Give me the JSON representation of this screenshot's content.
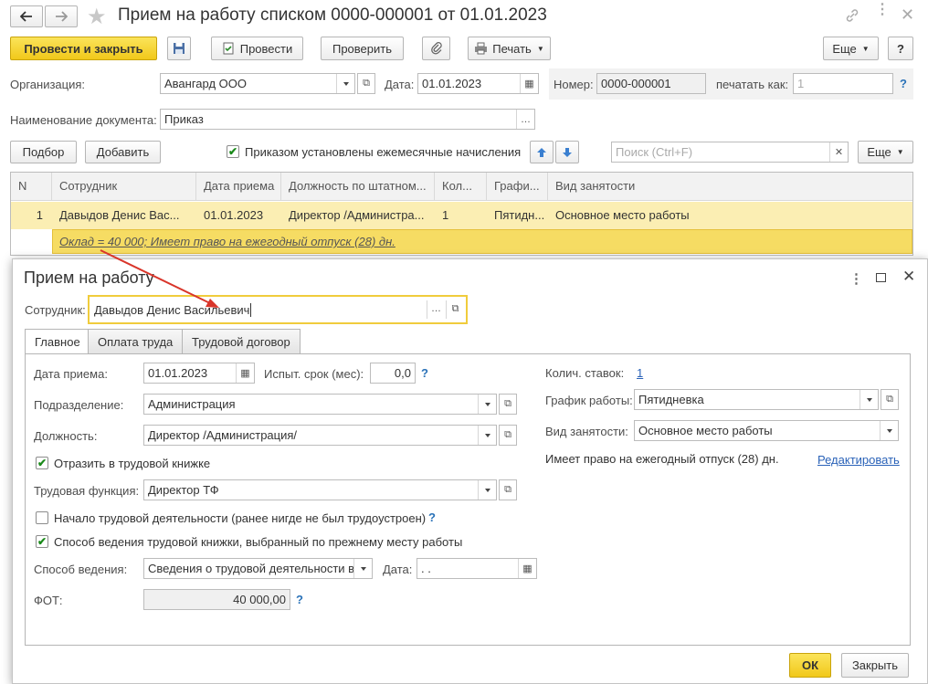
{
  "window": {
    "title": "Прием на работу списком 0000-000001 от 01.01.2023",
    "post_close": "Провести и закрыть",
    "post": "Провести",
    "check": "Проверить",
    "print": "Печать",
    "more": "Еще",
    "help": "?"
  },
  "header": {
    "org_label": "Организация:",
    "org_value": "Авангард ООО",
    "date_label": "Дата:",
    "date_value": "01.01.2023",
    "number_label": "Номер:",
    "number_value": "0000-000001",
    "print_as_label": "печатать как:",
    "print_as_value": "1",
    "help": "?",
    "docname_label": "Наименование документа:",
    "docname_value": "Приказ"
  },
  "toolbar2": {
    "select": "Подбор",
    "add": "Добавить",
    "monthly_label": "Приказом установлены ежемесячные начисления",
    "search_placeholder": "Поиск (Ctrl+F)",
    "more": "Еще"
  },
  "table": {
    "headers": [
      "N",
      "Сотрудник",
      "Дата приема",
      "Должность по штатном...",
      "Кол...",
      "Графи...",
      "Вид занятости"
    ],
    "row": {
      "n": "1",
      "employee": "Давыдов Денис Вас...",
      "date": "01.01.2023",
      "position": "Директор /Администра...",
      "count": "1",
      "schedule": "Пятидн...",
      "type": "Основное место работы"
    },
    "subline": "Оклад = 40 000; Имеет право на ежегодный отпуск (28) дн."
  },
  "dialog": {
    "title": "Прием на работу",
    "employee_label": "Сотрудник:",
    "employee_value": "Давыдов Денис Васильевич",
    "tabs": [
      "Главное",
      "Оплата труда",
      "Трудовой договор"
    ],
    "hire_date_label": "Дата приема:",
    "hire_date_value": "01.01.2023",
    "probation_label": "Испыт. срок (мес):",
    "probation_value": "0,0",
    "dept_label": "Подразделение:",
    "dept_value": "Администрация",
    "position_label": "Должность:",
    "position_value": "Директор /Администрация/",
    "reflect_label": "Отразить в трудовой книжке",
    "labor_func_label": "Трудовая функция:",
    "labor_func_value": "Директор ТФ",
    "start_activity_label": "Начало трудовой деятельности (ранее нигде не был трудоустроен)",
    "book_method_check_label": "Способ ведения трудовой книжки, выбранный по прежнему месту работы",
    "book_method_label": "Способ ведения:",
    "book_method_value": "Сведения о трудовой деятельности в",
    "date_label": "Дата:",
    "date_value": " .  .",
    "fot_label": "ФОТ:",
    "fot_value": "40 000,00",
    "rates_label": "Колич. ставок:",
    "rates_value": "1",
    "schedule_label": "График работы:",
    "schedule_value": "Пятидневка",
    "employment_label": "Вид занятости:",
    "employment_value": "Основное место работы",
    "vacation_text": "Имеет право на ежегодный отпуск (28) дн.",
    "edit_link": "Редактировать",
    "ok": "ОК",
    "close": "Закрыть",
    "help": "?"
  },
  "colors": {
    "accent_yellow": "#f5d33a",
    "row_highlight": "#fbeeb3",
    "link": "#2a62b8",
    "arrow": "#d9352a"
  }
}
